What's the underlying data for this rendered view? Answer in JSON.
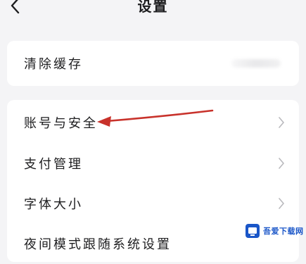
{
  "header": {
    "title": "设置",
    "back_icon": "chevron-left-icon"
  },
  "cache": {
    "label": "清除缓存"
  },
  "settings": {
    "items": [
      {
        "label": "账号与安全",
        "icon": "chevron-right-icon"
      },
      {
        "label": "支付管理",
        "icon": "chevron-right-icon"
      },
      {
        "label": "字体大小",
        "icon": "chevron-right-icon"
      },
      {
        "label": "夜间模式跟随系统设置"
      }
    ]
  },
  "annotation": {
    "arrow_color": "#c8322b"
  },
  "watermark": {
    "text": "吾爱下载网",
    "logo_icon": "watermark-logo-icon"
  }
}
